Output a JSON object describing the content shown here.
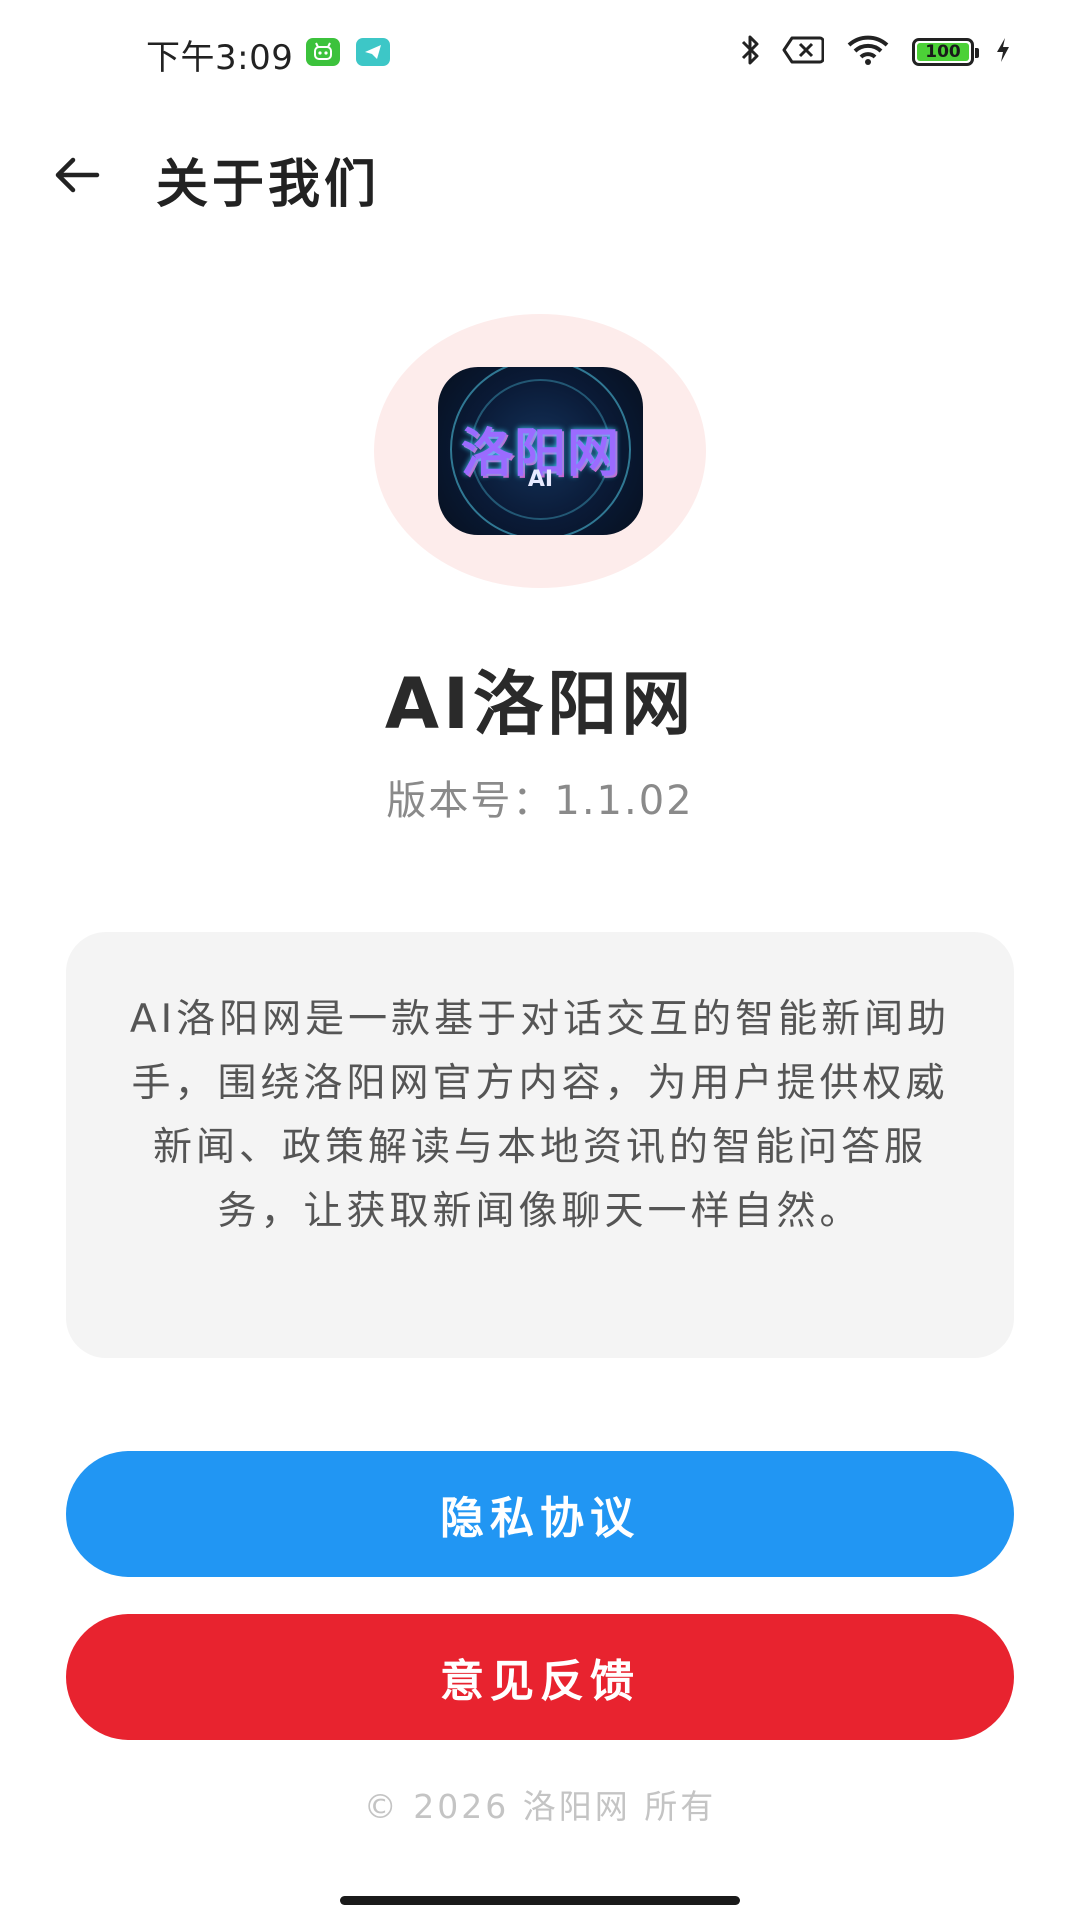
{
  "status_bar": {
    "time": "下午3:09",
    "battery_level": "100",
    "icons": [
      "green-app-notification-icon",
      "telegram-notification-icon",
      "bluetooth-icon",
      "no-sim-icon",
      "wifi-icon",
      "battery-icon",
      "charging-icon"
    ],
    "colors": {
      "battery_fill": "#4cd137",
      "green_app": "#3cc23c",
      "teal_app": "#3dc7c7"
    }
  },
  "header": {
    "title": "关于我们",
    "back_icon": "arrow-left-icon"
  },
  "app": {
    "logo_text": "洛阳网",
    "logo_subtext": "AI",
    "name": "AI洛阳网",
    "version": "版本号：1.1.02",
    "description": "AI洛阳网是一款基于对话交互的智能新闻助手，围绕洛阳网官方内容，为用户提供权威新闻、政策解读与本地资讯的智能问答服务，让获取新闻像聊天一样自然。"
  },
  "actions": {
    "privacy_label": "隐私协议",
    "feedback_label": "意见反馈",
    "colors": {
      "privacy": "#2196f3",
      "feedback": "#e8232f"
    }
  },
  "footer": {
    "copyright": "© 2026 洛阳网 所有"
  }
}
